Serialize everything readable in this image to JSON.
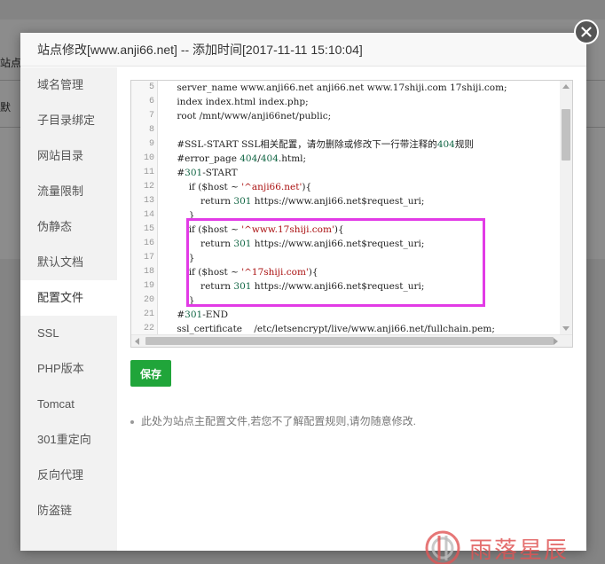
{
  "background": {
    "fragments": [
      "站点",
      "默"
    ]
  },
  "dialog": {
    "title": "站点修改[www.anji66.net] -- 添加时间[2017-11-11 15:10:04]"
  },
  "sidebar": {
    "items": [
      {
        "label": "域名管理"
      },
      {
        "label": "子目录绑定"
      },
      {
        "label": "网站目录"
      },
      {
        "label": "流量限制"
      },
      {
        "label": "伪静态"
      },
      {
        "label": "默认文档"
      },
      {
        "label": "配置文件",
        "active": true
      },
      {
        "label": "SSL"
      },
      {
        "label": "PHP版本"
      },
      {
        "label": "Tomcat"
      },
      {
        "label": "301重定向"
      },
      {
        "label": "反向代理"
      },
      {
        "label": "防盗链"
      }
    ]
  },
  "editor": {
    "lines": [
      {
        "n": "5",
        "t": "    server_name www.anji66.net anji66.net www.17shiji.com 17shiji.com;"
      },
      {
        "n": "6",
        "t": "    index index.html index.php;"
      },
      {
        "n": "7",
        "t": "    root /mnt/www/anji66net/public;"
      },
      {
        "n": "8",
        "t": ""
      },
      {
        "n": "9",
        "t": "    #SSL-START SSL相关配置，请勿删除或修改下一行带注释的404规则"
      },
      {
        "n": "10",
        "t": "    #error_page 404/404.html;"
      },
      {
        "n": "11",
        "t": "    #301-START"
      },
      {
        "n": "12",
        "t": "        if ($host ~ '^anji66.net'){"
      },
      {
        "n": "13",
        "t": "            return 301 https://www.anji66.net$request_uri;"
      },
      {
        "n": "14",
        "t": "        }"
      },
      {
        "n": "15",
        "t": "        if ($host ~ '^www.17shiji.com'){"
      },
      {
        "n": "16",
        "t": "            return 301 https://www.anji66.net$request_uri;"
      },
      {
        "n": "17",
        "t": "        }"
      },
      {
        "n": "18",
        "t": "        if ($host ~ '^17shiji.com'){"
      },
      {
        "n": "19",
        "t": "            return 301 https://www.anji66.net$request_uri;"
      },
      {
        "n": "20",
        "t": "        }"
      },
      {
        "n": "21",
        "t": "    #301-END"
      },
      {
        "n": "22",
        "t": "    ssl_certificate    /etc/letsencrypt/live/www.anji66.net/fullchain.pem;"
      }
    ]
  },
  "actions": {
    "save_label": "保存"
  },
  "tip": {
    "text": "此处为站点主配置文件,若您不了解配置规则,请勿随意修改."
  },
  "watermark": {
    "text": "雨落星辰"
  },
  "colors": {
    "accent": "#20a53a",
    "highlight": "#e23be6",
    "watermark": "#e05555"
  }
}
